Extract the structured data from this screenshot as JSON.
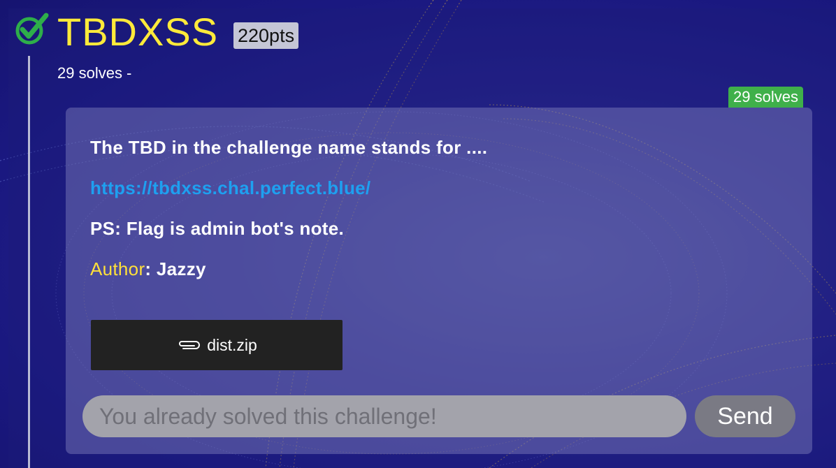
{
  "challenge": {
    "title": "TBDXSS",
    "points": "220pts",
    "solves_text": "29 solves -",
    "solves_badge": "29 solves",
    "status_icon": "check-icon"
  },
  "description": {
    "line1": "The TBD in the challenge name stands for ....",
    "link": "https://tbdxss.chal.perfect.blue/",
    "line3": "PS: Flag is admin bot's note.",
    "author_label": "Author",
    "author_sep": ": ",
    "author_name": "Jazzy"
  },
  "attachment": {
    "icon": "paperclip-icon",
    "filename": "dist.zip"
  },
  "flag_form": {
    "placeholder": "You already solved this challenge!",
    "send_label": "Send"
  },
  "colors": {
    "title": "#ffea3a",
    "solved_badge": "#3fb04a",
    "link": "#1ea0f0",
    "author_label": "#ffe03a"
  }
}
